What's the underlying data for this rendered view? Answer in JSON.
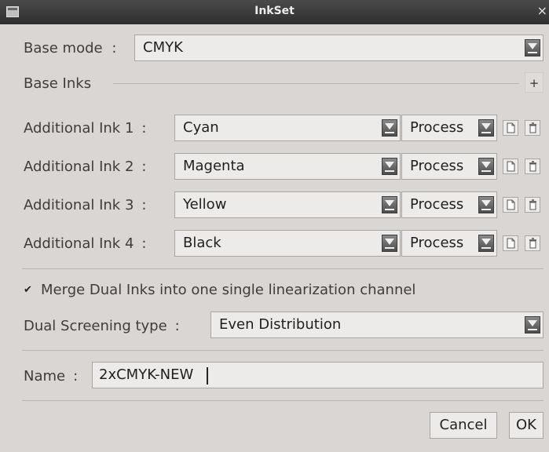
{
  "window": {
    "title": "InkSet",
    "close_glyph": "×"
  },
  "base_mode": {
    "label": "Base mode",
    "colon": ":",
    "value": "CMYK"
  },
  "base_inks": {
    "label": "Base Inks",
    "add_glyph": "+"
  },
  "inks": [
    {
      "label": "Additional Ink 1",
      "colon": ":",
      "name": "Cyan",
      "type": "Process"
    },
    {
      "label": "Additional Ink 2",
      "colon": ":",
      "name": "Magenta",
      "type": "Process"
    },
    {
      "label": "Additional Ink 3",
      "colon": ":",
      "name": "Yellow",
      "type": "Process"
    },
    {
      "label": "Additional Ink 4",
      "colon": ":",
      "name": "Black",
      "type": "Process"
    }
  ],
  "merge": {
    "checked": true,
    "check_glyph": "✔",
    "label": "Merge Dual Inks into one single linearization channel"
  },
  "dual_screening": {
    "label": "Dual Screening type",
    "colon": ":",
    "value": "Even Distribution"
  },
  "name_field": {
    "label": "Name",
    "colon": ":",
    "value": "2xCMYK-NEW"
  },
  "buttons": {
    "cancel": "Cancel",
    "ok": "OK"
  }
}
